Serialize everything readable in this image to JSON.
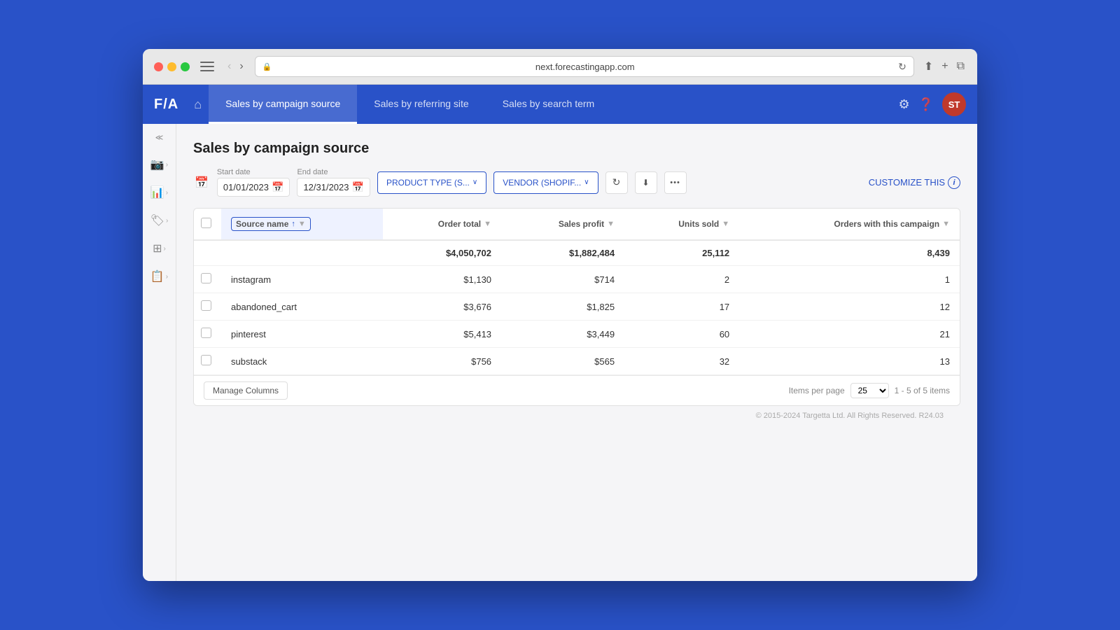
{
  "browser": {
    "url": "next.forecastingapp.com",
    "back_disabled": true,
    "forward_enabled": true
  },
  "app": {
    "logo": "F/A",
    "nav_tabs": [
      {
        "label": "Sales by campaign source",
        "active": true
      },
      {
        "label": "Sales by referring site",
        "active": false
      },
      {
        "label": "Sales by search term",
        "active": false
      }
    ],
    "avatar_initials": "ST"
  },
  "page": {
    "title": "Sales by campaign source",
    "start_date_label": "Start date",
    "start_date_value": "01/01/2023",
    "end_date_label": "End date",
    "end_date_value": "12/31/2023",
    "filters": [
      {
        "label": "PRODUCT TYPE (S..."
      },
      {
        "label": "VENDOR (SHOPIF..."
      }
    ],
    "customize_label": "CUSTOMIZE THIS",
    "table": {
      "columns": [
        {
          "label": "Source name",
          "sortable": true,
          "active": true
        },
        {
          "label": "Order total",
          "filterable": true
        },
        {
          "label": "Sales profit",
          "filterable": true
        },
        {
          "label": "Units sold",
          "filterable": true
        },
        {
          "label": "Orders with this campaign",
          "filterable": true
        }
      ],
      "total_row": {
        "order_total": "$4,050,702",
        "sales_profit": "$1,882,484",
        "units_sold": "25,112",
        "orders": "8,439"
      },
      "rows": [
        {
          "source": "instagram",
          "order_total": "$1,130",
          "sales_profit": "$714",
          "units_sold": "2",
          "orders": "1"
        },
        {
          "source": "abandoned_cart",
          "order_total": "$3,676",
          "sales_profit": "$1,825",
          "units_sold": "17",
          "orders": "12"
        },
        {
          "source": "pinterest",
          "order_total": "$5,413",
          "sales_profit": "$3,449",
          "units_sold": "60",
          "orders": "21"
        },
        {
          "source": "substack",
          "order_total": "$756",
          "sales_profit": "$565",
          "units_sold": "32",
          "orders": "13"
        }
      ],
      "items_per_page_label": "Items per page",
      "items_per_page_value": "25",
      "pagination": "1 - 5 of 5 items",
      "manage_columns_label": "Manage Columns"
    }
  },
  "footer": {
    "text": "© 2015-2024 Targetta Ltd. All Rights Reserved. R24.03"
  },
  "icons": {
    "home": "⌂",
    "gear": "⚙",
    "help": "?",
    "calendar": "📅",
    "reload": "↻",
    "chevron_down": "∨",
    "chevron_right": "›",
    "chevron_left": "‹",
    "sort_up": "↑",
    "filter": "▼",
    "more": "•••",
    "sidebar_chevron": "≪"
  }
}
